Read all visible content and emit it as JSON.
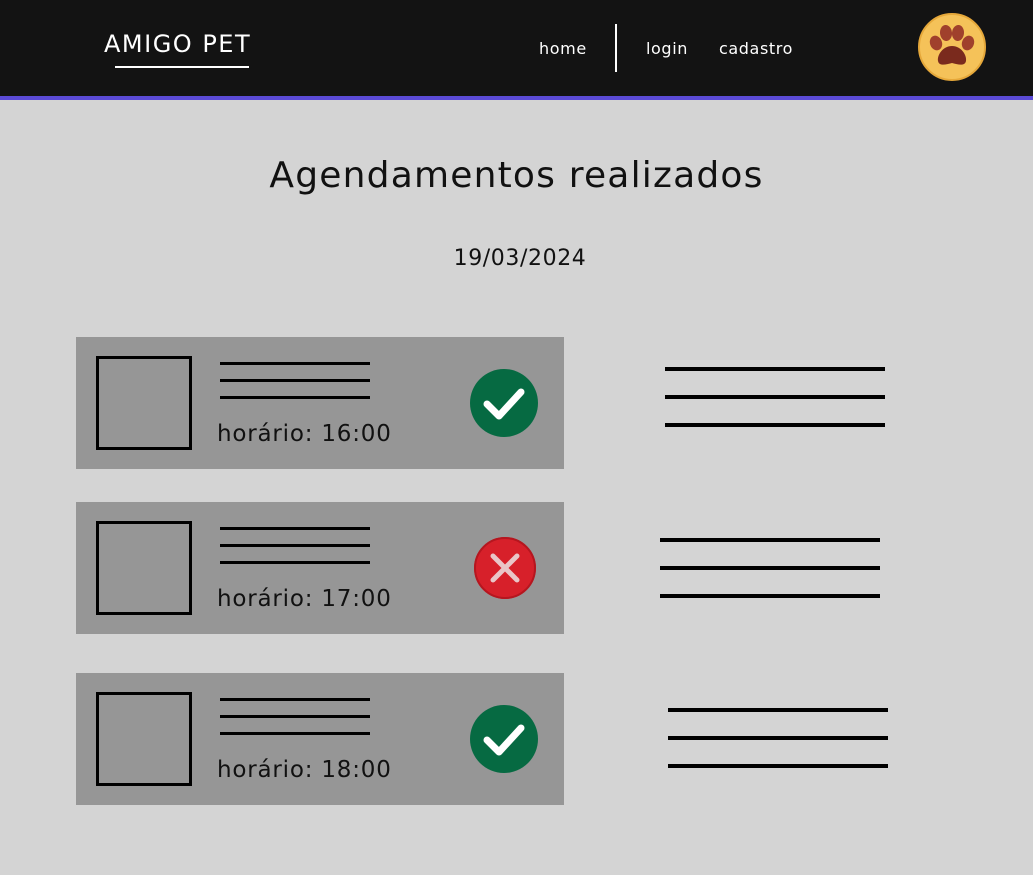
{
  "header": {
    "brand": "AMIGO PET",
    "nav": {
      "home": "home",
      "login": "login",
      "cadastro": "cadastro"
    },
    "avatar_icon": "paw-icon",
    "accent_color": "#5b4bd6"
  },
  "main": {
    "title": "Agendamentos realizados",
    "date": "19/03/2024",
    "appointments": [
      {
        "time": "horário: 16:00",
        "status": "confirmed",
        "status_icon": "check-circle-icon",
        "status_color": "#066a42"
      },
      {
        "time": "horário: 17:00",
        "status": "cancelled",
        "status_icon": "x-circle-icon",
        "status_color": "#d7202a"
      },
      {
        "time": "horário: 18:00",
        "status": "confirmed",
        "status_icon": "check-circle-icon",
        "status_color": "#066a42"
      }
    ]
  }
}
